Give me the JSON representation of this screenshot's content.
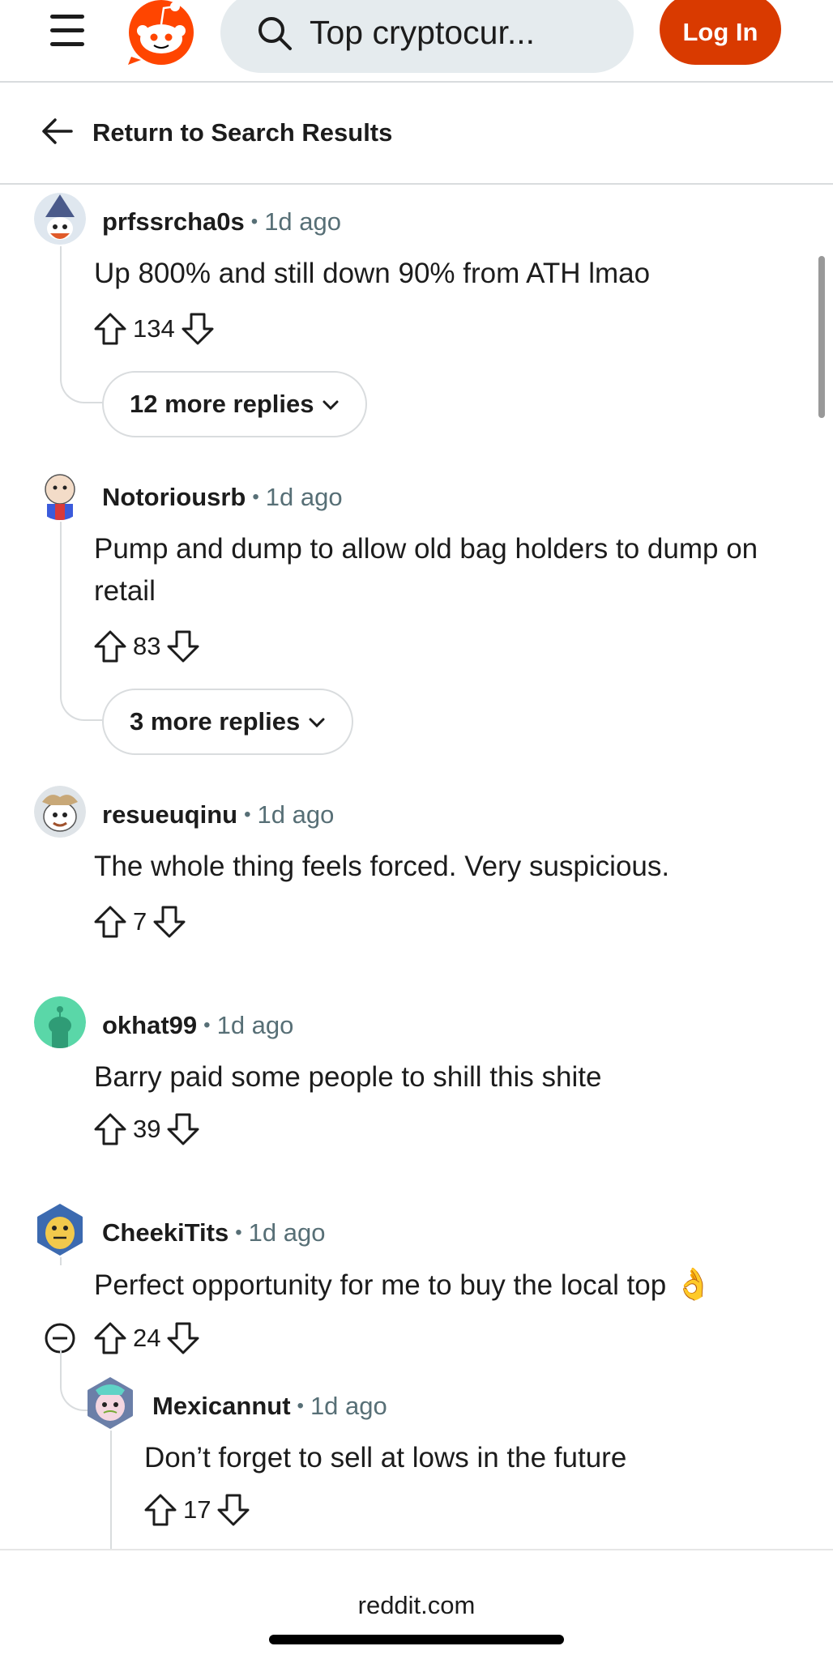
{
  "header": {
    "search_query": "Top cryptocur...",
    "login_label": "Log In",
    "return_label": "Return to Search Results",
    "brand_color": "#d93a00"
  },
  "comments": [
    {
      "author": "prfssrcha0s",
      "time": "1d ago",
      "body": "Up 800% and still down 90% from ATH lmao",
      "score": "134",
      "more_replies": "12 more replies"
    },
    {
      "author": "Notoriousrb",
      "time": "1d ago",
      "body": "Pump and dump to allow old bag holders to dump on retail",
      "score": "83",
      "more_replies": "3 more replies"
    },
    {
      "author": "resueuqinu",
      "time": "1d ago",
      "body": "The whole thing feels forced. Very suspicious.",
      "score": "7"
    },
    {
      "author": "okhat99",
      "time": "1d ago",
      "body": "Barry paid some people to shill this shite",
      "score": "39"
    },
    {
      "author": "CheekiTits",
      "time": "1d ago",
      "body": "Perfect opportunity for me to buy the local top",
      "emoji": "👌",
      "score": "24"
    },
    {
      "author": "Mexicannut",
      "time": "1d ago",
      "body": "Don’t forget to sell at lows in the future",
      "score": "17"
    }
  ],
  "footer": {
    "domain": "reddit.com"
  }
}
